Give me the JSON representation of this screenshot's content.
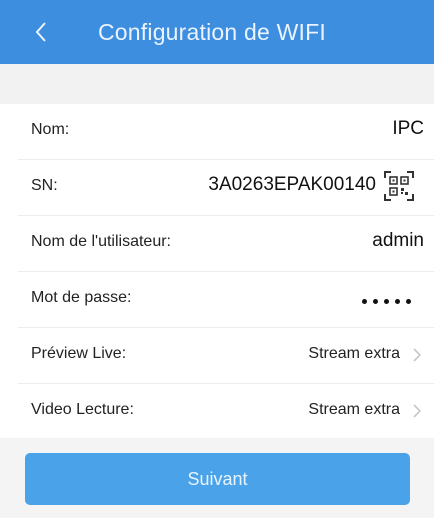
{
  "header": {
    "title": "Configuration de WIFI",
    "back_icon": "chevron-left-icon"
  },
  "form": {
    "name": {
      "label": "Nom:",
      "value": "IPC"
    },
    "sn": {
      "label": "SN:",
      "value": "3A0263EPAK00140",
      "icon": "qr-code-icon"
    },
    "username": {
      "label": "Nom de l'utilisateur:",
      "value": "admin"
    },
    "password": {
      "label": "Mot de passe:",
      "masked_value": "•••••"
    },
    "preview_live": {
      "label": "Préview Live:",
      "value": "Stream extra",
      "icon": "chevron-right-icon"
    },
    "video_playback": {
      "label": "Video Lecture:",
      "value": "Stream extra",
      "icon": "chevron-right-icon"
    }
  },
  "footer": {
    "next_label": "Suivant"
  },
  "colors": {
    "header_bg": "#3d8ede",
    "button_bg": "#4aa3e8",
    "page_bg": "#f4f4f4"
  }
}
